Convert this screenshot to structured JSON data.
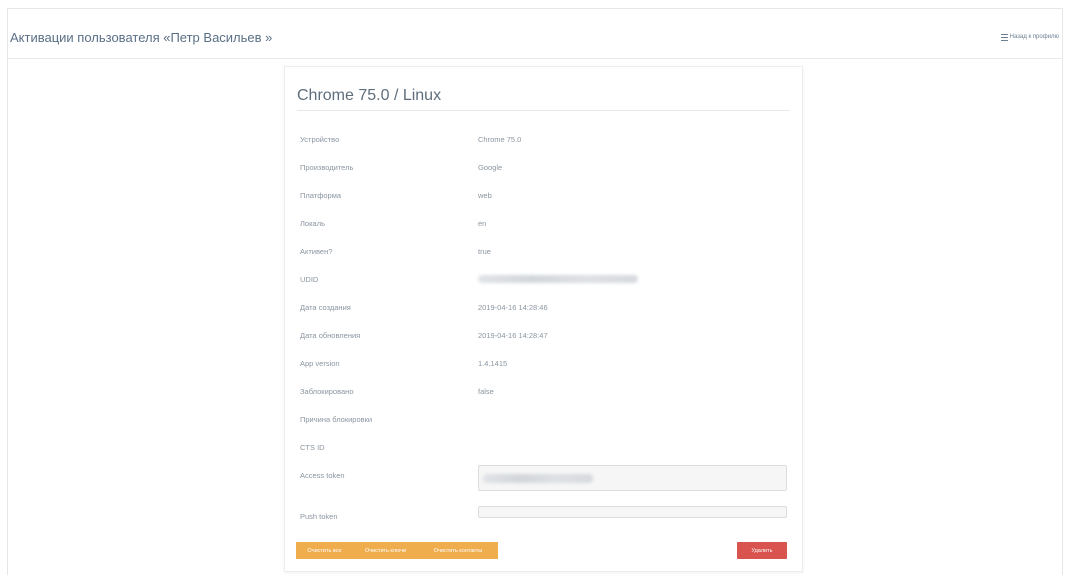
{
  "header": {
    "title": "Активации пользователя «Петр Васильев »",
    "back_label": "Назад к профилю"
  },
  "card": {
    "title": "Chrome 75.0 / Linux",
    "rows": [
      {
        "label": "Устройство",
        "value": "Chrome 75.0"
      },
      {
        "label": "Производитель",
        "value": "Google"
      },
      {
        "label": "Платформа",
        "value": "web"
      },
      {
        "label": "Локаль",
        "value": "en"
      },
      {
        "label": "Активен?",
        "value": "true"
      },
      {
        "label": "UDID",
        "value": ""
      },
      {
        "label": "Дата создания",
        "value": "2019-04-16 14:28:46"
      },
      {
        "label": "Дата обновления",
        "value": "2019-04-16 14:28:47"
      },
      {
        "label": "App version",
        "value": "1.4.1415"
      },
      {
        "label": "Заблокировано",
        "value": "false"
      },
      {
        "label": "Причина блокировки",
        "value": ""
      },
      {
        "label": "CTS ID",
        "value": ""
      }
    ],
    "access_token_label": "Access token",
    "push_token_label": "Push token"
  },
  "buttons": {
    "clear_all": "Очистить все",
    "clear_keys": "Очистить ключи",
    "clear_contacts": "Очистить контакты",
    "delete": "Удалить"
  },
  "colors": {
    "accent_orange": "#f0ad4e",
    "danger_red": "#d9534f",
    "title_blue": "#5a6f86"
  }
}
